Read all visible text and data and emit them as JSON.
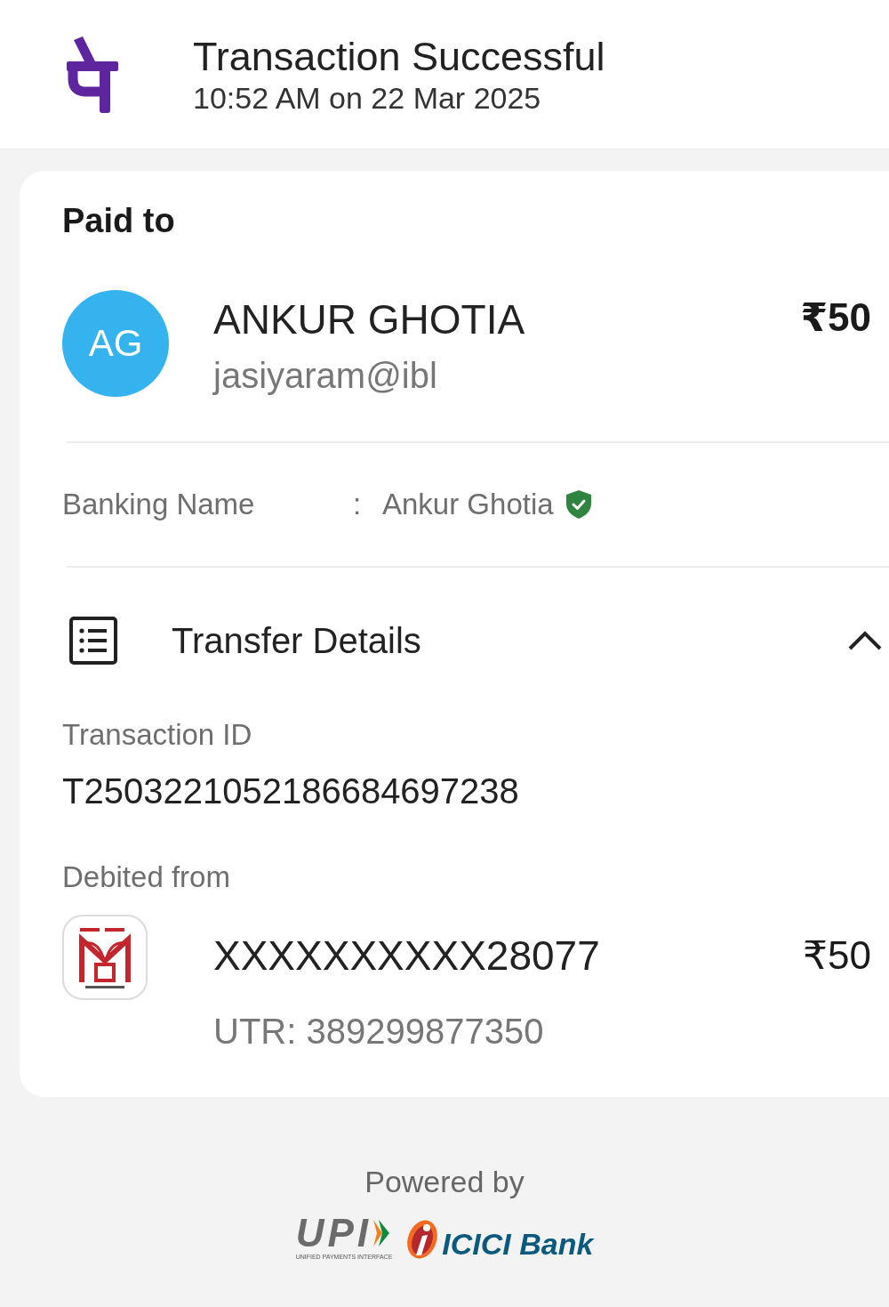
{
  "header": {
    "title": "Transaction Successful",
    "timestamp": "10:52 AM on 22 Mar 2025"
  },
  "paid_to": {
    "heading": "Paid to",
    "initials": "AG",
    "name": "ANKUR GHOTIA",
    "upi_id": "jasiyaram@ibl",
    "amount": "₹50"
  },
  "banking_name": {
    "label": "Banking Name",
    "separator": ":",
    "value": "Ankur Ghotia",
    "verified": true
  },
  "transfer_details": {
    "title": "Transfer Details",
    "expanded": true,
    "fields": [
      {
        "label": "Transaction ID",
        "value": "T2503221052186684697238"
      }
    ],
    "debited_from": {
      "label": "Debited from",
      "account": "XXXXXXXXXX28077",
      "amount": "₹50",
      "utr": "UTR: 389299877350"
    }
  },
  "footer": {
    "powered_by": "Powered by",
    "logos": [
      {
        "kind": "upi",
        "text": "UPI",
        "tagline": "UNIFIED PAYMENTS INTERFACE"
      },
      {
        "kind": "bank",
        "text": "ICICI Bank"
      }
    ]
  }
}
